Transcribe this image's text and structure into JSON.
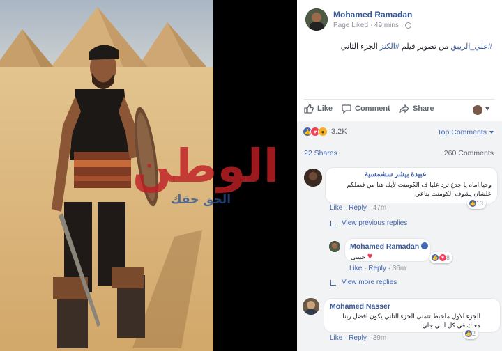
{
  "post": {
    "author": "Mohamed Ramadan",
    "meta": "Page Liked · 49 mins ·",
    "text_hashtag_1": "#علي_الزيبق",
    "text_middle": " من تصوير فيلم ",
    "text_hashtag_2": "#الكنز",
    "text_end": " الجزء الثاني"
  },
  "actions": {
    "like": "Like",
    "comment": "Comment",
    "share": "Share"
  },
  "feedback": {
    "reaction_count": "3.2K",
    "top_comments": "Top Comments",
    "shares": "22 Shares",
    "comments": "260 Comments"
  },
  "comments": [
    {
      "name": "عبيدة بيشر سشمسية",
      "line1": "وحيا اماه يا جدع ترد عليا ف الكومنت لأيك هنا من فضلكم",
      "line2": "علشان يشوف الكومنت بتاعي",
      "like": "Like",
      "reply": "Reply",
      "time": "47m",
      "reactions": "13"
    },
    {
      "view_previous": "View previous replies"
    },
    {
      "name": "Mohamed Ramadan",
      "text": "حبيبي",
      "like": "Like",
      "reply": "Reply",
      "time": "36m",
      "reactions": "8"
    },
    {
      "view_more": "View more replies"
    },
    {
      "name": "Mohamed Nasser",
      "line1": "الجزء الاول ملخبط تتمنى الجزء التاني يكون افضل ربنا",
      "line2": "معاك في كل اللي جاي",
      "like": "Like",
      "reply": "Reply",
      "time": "39m",
      "reactions": "2"
    }
  ],
  "watermark": {
    "big": "الوطن",
    "small": "الحق حقك"
  },
  "colors": {
    "link": "#365899",
    "accent": "#4267b2",
    "like_blue": "#4267b2",
    "love_red": "#f33e58",
    "haha_yellow": "#f7b125",
    "sand": "#d9b57a",
    "sky": "#b9c3cf"
  },
  "icons": [
    "globe-icon",
    "like-icon",
    "comment-icon",
    "share-icon",
    "caret-down-icon",
    "reaction-like-icon",
    "reaction-love-icon",
    "reaction-wow-icon",
    "reply-arrow-icon",
    "verified-icon"
  ]
}
